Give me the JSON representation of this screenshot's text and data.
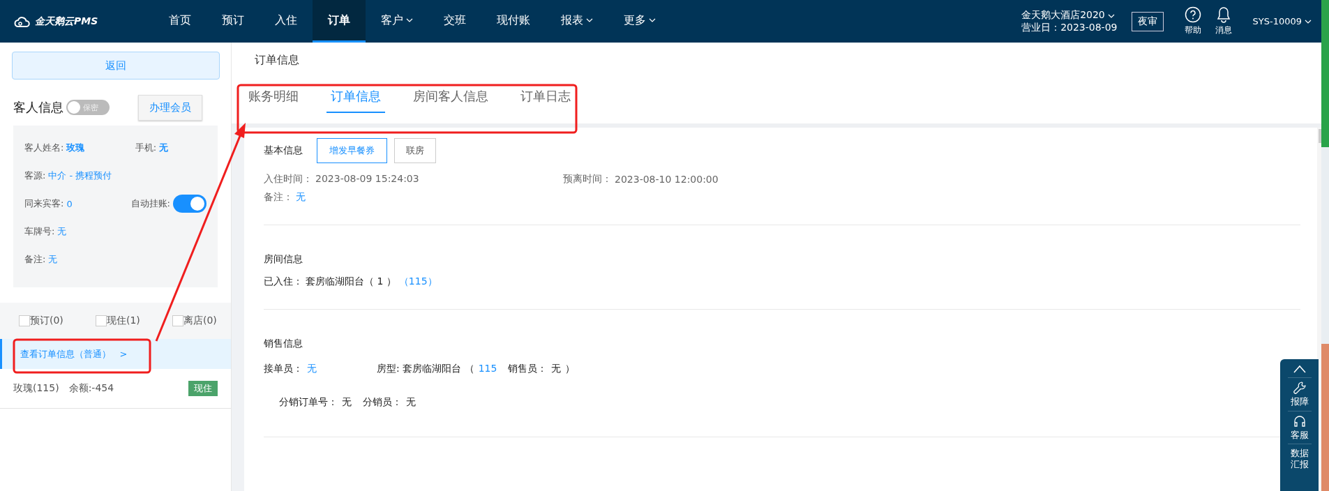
{
  "app": {
    "logo": "金天鹅云PMS"
  },
  "nav": [
    {
      "label": "首页",
      "selected": false,
      "dropdown": false
    },
    {
      "label": "预订",
      "selected": false,
      "dropdown": false
    },
    {
      "label": "入住",
      "selected": false,
      "dropdown": false
    },
    {
      "label": "订单",
      "selected": true,
      "dropdown": false
    },
    {
      "label": "客户",
      "selected": false,
      "dropdown": true
    },
    {
      "label": "交班",
      "selected": false,
      "dropdown": false
    },
    {
      "label": "现付账",
      "selected": false,
      "dropdown": false
    },
    {
      "label": "报表",
      "selected": false,
      "dropdown": true
    },
    {
      "label": "更多",
      "selected": false,
      "dropdown": true
    }
  ],
  "hotel": {
    "name": "金天鹅大酒店2020",
    "business_date": "营业日：2023-08-09"
  },
  "night_audit": "夜审",
  "tools": [
    {
      "label": "帮助",
      "kind": "help"
    },
    {
      "label": "消息",
      "kind": "bell"
    }
  ],
  "user": "SYS-10009",
  "sidebar": {
    "back": "返回",
    "guest_title": "客人信息",
    "privacy_toggle": {
      "label": "保密",
      "on": false
    },
    "member_button": "办理会员",
    "guest_rows": [
      [
        {
          "label": "客人姓名:",
          "value": "玫瑰",
          "kind": "strong"
        },
        {
          "label": "手机:",
          "value": "无",
          "kind": "strong"
        }
      ],
      [
        {
          "label": "客源:",
          "value": "中介  - 携程预付",
          "kind": "text"
        }
      ],
      [
        {
          "label": "同来宾客:",
          "value": "0",
          "kind": "text"
        },
        {
          "label": "自动挂账:",
          "on": true,
          "kind": "toggle"
        }
      ],
      [
        {
          "label": "车牌号:",
          "value": "无",
          "kind": "text"
        }
      ],
      [
        {
          "label": "备注:",
          "value": "无",
          "kind": "text"
        }
      ]
    ],
    "filters": [
      {
        "label": "预订(0)",
        "checked": false
      },
      {
        "label": "现住(1)",
        "checked": false
      },
      {
        "label": "离店(0)",
        "checked": false
      }
    ],
    "order_link": {
      "label": "查看订单信息（普通）",
      "arrow": ">",
      "selected": true
    },
    "rooms": [
      {
        "name": "玫瑰(115)",
        "balance": "余额:-454",
        "status": "现住"
      }
    ]
  },
  "main": {
    "title": "订单信息",
    "tabs": [
      {
        "label": "账务明细",
        "selected": false
      },
      {
        "label": "订单信息",
        "selected": true
      },
      {
        "label": "房间客人信息",
        "selected": false
      },
      {
        "label": "订单日志",
        "selected": false
      }
    ],
    "basic": {
      "title": "基本信息",
      "buttons": [
        {
          "label": "增发早餐券",
          "kind": "primary"
        },
        {
          "label": "联房",
          "kind": "default"
        }
      ],
      "checkin": {
        "label": "入住时间：",
        "value": "2023-08-09 15:24:03"
      },
      "departure": {
        "label": "预离时间：",
        "value": "2023-08-10 12:00:00"
      },
      "remark": {
        "label": "备注：",
        "value": "无"
      }
    },
    "room": {
      "title": "房间信息",
      "label": "已入住：",
      "room_type": "套房临湖阳台（ 1 ）",
      "room_no": "（115）"
    },
    "sales": {
      "title": "销售信息",
      "lines": [
        [
          {
            "text": "接单员：",
            "kind": "label"
          },
          {
            "text": "无",
            "kind": "link"
          },
          {
            "text": "房型: 套房临湖阳台 （",
            "kind": "label"
          },
          {
            "text": "115",
            "kind": "link"
          },
          {
            "text": "销售员：",
            "kind": "label"
          },
          {
            "text": "无",
            "kind": "value"
          },
          {
            "text": "）",
            "kind": "value"
          }
        ],
        [
          {
            "text": "分销订单号：",
            "kind": "label"
          },
          {
            "text": "无",
            "kind": "value"
          },
          {
            "text": "分销员：",
            "kind": "label"
          },
          {
            "text": "无",
            "kind": "value"
          }
        ]
      ]
    }
  },
  "float_panel": [
    {
      "label": "报障",
      "kind": "wrench"
    },
    {
      "label": "客服",
      "kind": "headset"
    },
    {
      "label": "数据汇报",
      "kind": "none"
    }
  ]
}
